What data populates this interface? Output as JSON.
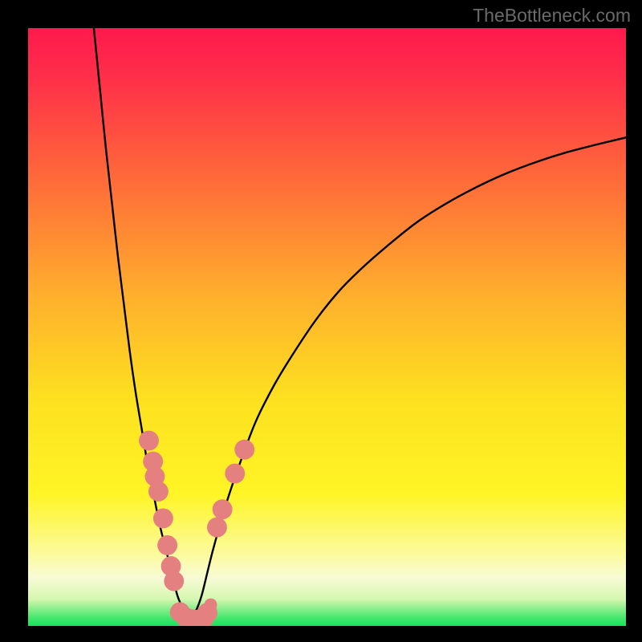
{
  "watermark": "TheBottleneck.com",
  "colors": {
    "frame_bg": "#000000",
    "curve_stroke": "#000000",
    "marker_fill": "#e48080",
    "gradient_stops": [
      {
        "pos": 0.0,
        "color": "#ff1a4d"
      },
      {
        "pos": 0.08,
        "color": "#ff2e4a"
      },
      {
        "pos": 0.25,
        "color": "#ff6a3a"
      },
      {
        "pos": 0.45,
        "color": "#ffb02d"
      },
      {
        "pos": 0.62,
        "color": "#fde120"
      },
      {
        "pos": 0.78,
        "color": "#fff526"
      },
      {
        "pos": 0.88,
        "color": "#fcfb9e"
      },
      {
        "pos": 0.92,
        "color": "#f8fbd6"
      },
      {
        "pos": 0.955,
        "color": "#d6f7b0"
      },
      {
        "pos": 0.985,
        "color": "#4be86f"
      },
      {
        "pos": 1.0,
        "color": "#15e25f"
      }
    ]
  },
  "chart_data": {
    "type": "line",
    "title": "",
    "xlabel": "",
    "ylabel": "",
    "xlim": [
      0,
      100
    ],
    "ylim": [
      0,
      100
    ],
    "notch_x": 27,
    "series": [
      {
        "name": "left-curve",
        "x": [
          11,
          12,
          13,
          14,
          15,
          16,
          17,
          18,
          19,
          20,
          21,
          22,
          23,
          24,
          25,
          26,
          27
        ],
        "y": [
          100,
          90,
          80,
          71,
          62,
          54,
          46,
          39,
          33,
          27,
          22,
          17,
          13,
          9,
          5,
          2.8,
          1.2
        ]
      },
      {
        "name": "right-curve",
        "x": [
          27,
          28,
          29,
          30,
          31,
          33,
          35,
          38,
          41,
          44,
          48,
          52,
          56,
          60,
          65,
          70,
          75,
          80,
          85,
          90,
          95,
          100
        ],
        "y": [
          1.2,
          2.4,
          5,
          9,
          13,
          20,
          26,
          34,
          40,
          45,
          51,
          56,
          60,
          63.5,
          67.5,
          70.7,
          73.4,
          75.7,
          77.6,
          79.2,
          80.5,
          81.7
        ]
      },
      {
        "name": "floor",
        "x": [
          25,
          26,
          27,
          28,
          29,
          30
        ],
        "y": [
          2.0,
          1.3,
          1.1,
          1.2,
          1.5,
          2.0
        ]
      }
    ],
    "markers": {
      "left_cluster": [
        {
          "x": 20.2,
          "y": 31.0,
          "r": 1.2
        },
        {
          "x": 20.9,
          "y": 27.5,
          "r": 1.2
        },
        {
          "x": 21.2,
          "y": 25.0,
          "r": 1.2
        },
        {
          "x": 21.8,
          "y": 22.5,
          "r": 1.2
        },
        {
          "x": 22.6,
          "y": 18.0,
          "r": 1.2
        },
        {
          "x": 23.3,
          "y": 13.5,
          "r": 1.2
        },
        {
          "x": 23.9,
          "y": 10.0,
          "r": 1.2
        },
        {
          "x": 24.4,
          "y": 7.5,
          "r": 1.2
        }
      ],
      "right_cluster": [
        {
          "x": 31.6,
          "y": 16.5,
          "r": 1.2
        },
        {
          "x": 32.5,
          "y": 19.5,
          "r": 1.2
        },
        {
          "x": 34.6,
          "y": 25.5,
          "r": 1.2
        },
        {
          "x": 36.2,
          "y": 29.5,
          "r": 1.2
        }
      ],
      "bottom_cluster": [
        {
          "x": 25.4,
          "y": 2.3,
          "r": 1.2
        },
        {
          "x": 26.4,
          "y": 1.4,
          "r": 1.2
        },
        {
          "x": 27.5,
          "y": 1.1,
          "r": 1.2
        },
        {
          "x": 28.6,
          "y": 1.1,
          "r": 1.2
        },
        {
          "x": 29.4,
          "y": 1.3,
          "r": 1.2
        },
        {
          "x": 30.0,
          "y": 2.2,
          "r": 1.2
        }
      ]
    }
  }
}
